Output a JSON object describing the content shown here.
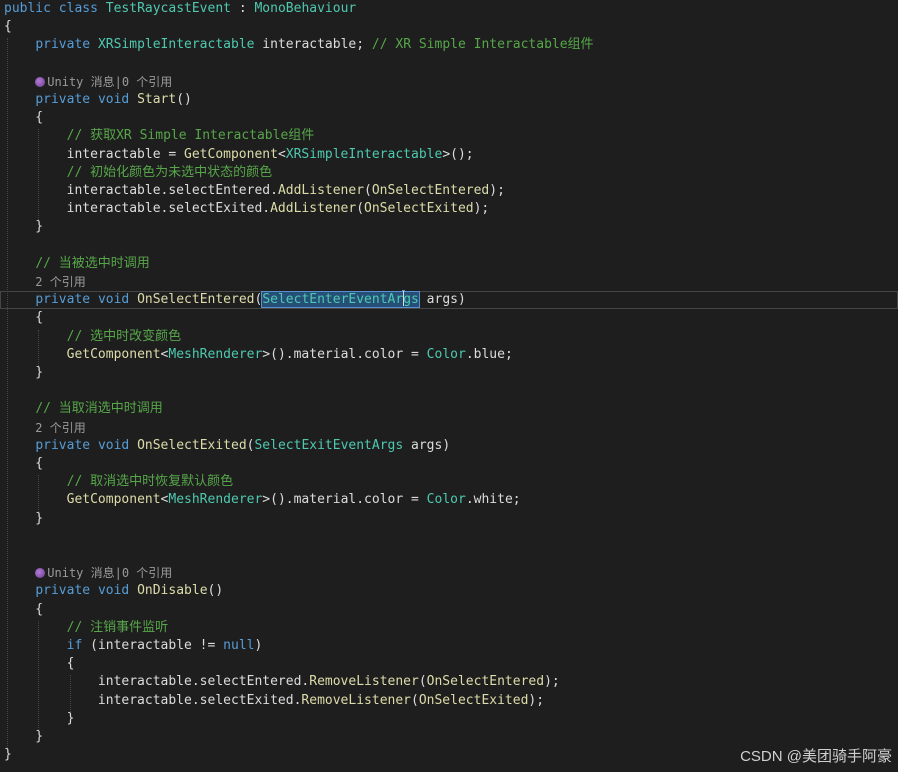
{
  "colors": {
    "background": "#1e1e1e",
    "keyword": "#569cd6",
    "type": "#4ec9b0",
    "method": "#dcdcaa",
    "comment": "#57a64a",
    "plain": "#dcdcdc",
    "codelens": "#9a9a9a",
    "selection": "#264f78",
    "unity_icon": "#9b59b6"
  },
  "code": [
    {
      "kind": "code",
      "tokens": [
        {
          "t": "public",
          "c": "keyword"
        },
        {
          "t": " "
        },
        {
          "t": "class",
          "c": "keyword"
        },
        {
          "t": " "
        },
        {
          "t": "TestRaycastEvent",
          "c": "type"
        },
        {
          "t": " : "
        },
        {
          "t": "MonoBehaviour",
          "c": "type"
        }
      ]
    },
    {
      "kind": "code",
      "tokens": [
        {
          "t": "{"
        }
      ]
    },
    {
      "kind": "code",
      "tokens": [
        {
          "t": "    "
        },
        {
          "t": "private",
          "c": "keyword"
        },
        {
          "t": " "
        },
        {
          "t": "XRSimpleInteractable",
          "c": "type"
        },
        {
          "t": " interactable; "
        },
        {
          "t": "// XR Simple Interactable组件",
          "c": "comment"
        }
      ]
    },
    {
      "kind": "blank"
    },
    {
      "kind": "lens",
      "unity": true,
      "indent": "    ",
      "text": "Unity 消息|0 个引用"
    },
    {
      "kind": "code",
      "tokens": [
        {
          "t": "    "
        },
        {
          "t": "private",
          "c": "keyword"
        },
        {
          "t": " "
        },
        {
          "t": "void",
          "c": "keyword"
        },
        {
          "t": " "
        },
        {
          "t": "Start",
          "c": "method"
        },
        {
          "t": "()"
        }
      ]
    },
    {
      "kind": "code",
      "tokens": [
        {
          "t": "    {"
        }
      ]
    },
    {
      "kind": "code",
      "tokens": [
        {
          "t": "        "
        },
        {
          "t": "// 获取XR Simple Interactable组件",
          "c": "comment"
        }
      ]
    },
    {
      "kind": "code",
      "tokens": [
        {
          "t": "        interactable = "
        },
        {
          "t": "GetComponent",
          "c": "method"
        },
        {
          "t": "<"
        },
        {
          "t": "XRSimpleInteractable",
          "c": "type"
        },
        {
          "t": ">();"
        }
      ]
    },
    {
      "kind": "code",
      "tokens": [
        {
          "t": "        "
        },
        {
          "t": "// 初始化颜色为未选中状态的颜色",
          "c": "comment"
        }
      ]
    },
    {
      "kind": "code",
      "tokens": [
        {
          "t": "        interactable.selectEntered."
        },
        {
          "t": "AddListener",
          "c": "method"
        },
        {
          "t": "("
        },
        {
          "t": "OnSelectEntered",
          "c": "method"
        },
        {
          "t": ");"
        }
      ]
    },
    {
      "kind": "code",
      "tokens": [
        {
          "t": "        interactable.selectExited."
        },
        {
          "t": "AddListener",
          "c": "method"
        },
        {
          "t": "("
        },
        {
          "t": "OnSelectExited",
          "c": "method"
        },
        {
          "t": ");"
        }
      ]
    },
    {
      "kind": "code",
      "tokens": [
        {
          "t": "    }"
        }
      ]
    },
    {
      "kind": "blank"
    },
    {
      "kind": "code",
      "tokens": [
        {
          "t": "    "
        },
        {
          "t": "// 当被选中时调用",
          "c": "comment"
        }
      ]
    },
    {
      "kind": "lens",
      "unity": false,
      "indent": "    ",
      "text": "2 个引用"
    },
    {
      "kind": "code",
      "current": true,
      "tokens": [
        {
          "t": "    "
        },
        {
          "t": "private",
          "c": "keyword"
        },
        {
          "t": " "
        },
        {
          "t": "void",
          "c": "keyword"
        },
        {
          "t": " "
        },
        {
          "t": "OnSelectEntered",
          "c": "method"
        },
        {
          "t": "("
        },
        {
          "t": "SelectEnterEventArgs",
          "c": "type",
          "sel": true
        },
        {
          "t": " args)"
        }
      ]
    },
    {
      "kind": "code",
      "tokens": [
        {
          "t": "    {"
        }
      ]
    },
    {
      "kind": "code",
      "tokens": [
        {
          "t": "        "
        },
        {
          "t": "// 选中时改变颜色",
          "c": "comment"
        }
      ]
    },
    {
      "kind": "code",
      "tokens": [
        {
          "t": "        "
        },
        {
          "t": "GetComponent",
          "c": "method"
        },
        {
          "t": "<"
        },
        {
          "t": "MeshRenderer",
          "c": "type"
        },
        {
          "t": ">().material.color = "
        },
        {
          "t": "Color",
          "c": "type"
        },
        {
          "t": ".blue;"
        }
      ]
    },
    {
      "kind": "code",
      "tokens": [
        {
          "t": "    }"
        }
      ]
    },
    {
      "kind": "blank"
    },
    {
      "kind": "code",
      "tokens": [
        {
          "t": "    "
        },
        {
          "t": "// 当取消选中时调用",
          "c": "comment"
        }
      ]
    },
    {
      "kind": "lens",
      "unity": false,
      "indent": "    ",
      "text": "2 个引用"
    },
    {
      "kind": "code",
      "tokens": [
        {
          "t": "    "
        },
        {
          "t": "private",
          "c": "keyword"
        },
        {
          "t": " "
        },
        {
          "t": "void",
          "c": "keyword"
        },
        {
          "t": " "
        },
        {
          "t": "OnSelectExited",
          "c": "method"
        },
        {
          "t": "("
        },
        {
          "t": "SelectExitEventArgs",
          "c": "type"
        },
        {
          "t": " args)"
        }
      ]
    },
    {
      "kind": "code",
      "tokens": [
        {
          "t": "    {"
        }
      ]
    },
    {
      "kind": "code",
      "tokens": [
        {
          "t": "        "
        },
        {
          "t": "// 取消选中时恢复默认颜色",
          "c": "comment"
        }
      ]
    },
    {
      "kind": "code",
      "tokens": [
        {
          "t": "        "
        },
        {
          "t": "GetComponent",
          "c": "method"
        },
        {
          "t": "<"
        },
        {
          "t": "MeshRenderer",
          "c": "type"
        },
        {
          "t": ">().material.color = "
        },
        {
          "t": "Color",
          "c": "type"
        },
        {
          "t": ".white;"
        }
      ]
    },
    {
      "kind": "code",
      "tokens": [
        {
          "t": "    }"
        }
      ]
    },
    {
      "kind": "blank"
    },
    {
      "kind": "blank"
    },
    {
      "kind": "lens",
      "unity": true,
      "indent": "    ",
      "text": "Unity 消息|0 个引用"
    },
    {
      "kind": "code",
      "tokens": [
        {
          "t": "    "
        },
        {
          "t": "private",
          "c": "keyword"
        },
        {
          "t": " "
        },
        {
          "t": "void",
          "c": "keyword"
        },
        {
          "t": " "
        },
        {
          "t": "OnDisable",
          "c": "method"
        },
        {
          "t": "()"
        }
      ]
    },
    {
      "kind": "code",
      "tokens": [
        {
          "t": "    {"
        }
      ]
    },
    {
      "kind": "code",
      "tokens": [
        {
          "t": "        "
        },
        {
          "t": "// 注销事件监听",
          "c": "comment"
        }
      ]
    },
    {
      "kind": "code",
      "tokens": [
        {
          "t": "        "
        },
        {
          "t": "if",
          "c": "keyword"
        },
        {
          "t": " (interactable != "
        },
        {
          "t": "null",
          "c": "keyword"
        },
        {
          "t": ")"
        }
      ]
    },
    {
      "kind": "code",
      "tokens": [
        {
          "t": "        {"
        }
      ]
    },
    {
      "kind": "code",
      "tokens": [
        {
          "t": "            interactable.selectEntered."
        },
        {
          "t": "RemoveListener",
          "c": "method"
        },
        {
          "t": "("
        },
        {
          "t": "OnSelectEntered",
          "c": "method"
        },
        {
          "t": ");"
        }
      ]
    },
    {
      "kind": "code",
      "tokens": [
        {
          "t": "            interactable.selectExited."
        },
        {
          "t": "RemoveListener",
          "c": "method"
        },
        {
          "t": "("
        },
        {
          "t": "OnSelectExited",
          "c": "method"
        },
        {
          "t": ");"
        }
      ]
    },
    {
      "kind": "code",
      "tokens": [
        {
          "t": "        }"
        }
      ]
    },
    {
      "kind": "code",
      "tokens": [
        {
          "t": "    }"
        }
      ]
    },
    {
      "kind": "code",
      "tokens": [
        {
          "t": "}"
        }
      ]
    }
  ],
  "watermark": "CSDN @美团骑手阿豪"
}
